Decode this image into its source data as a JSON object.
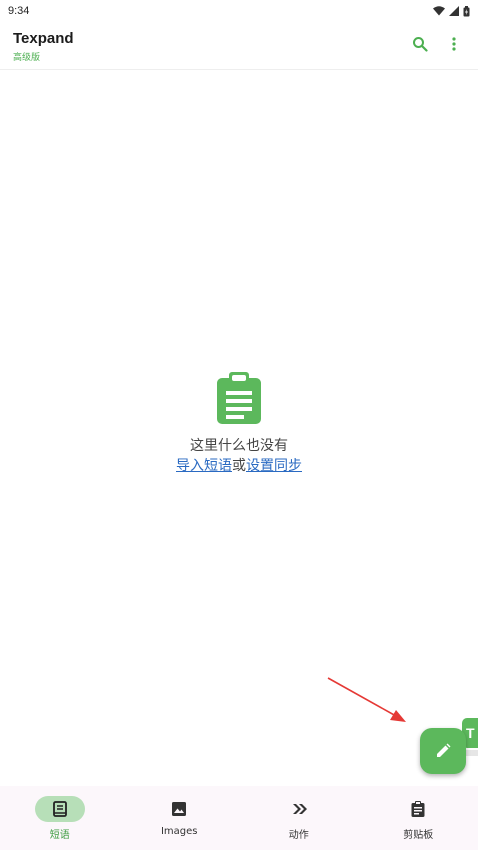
{
  "status_bar": {
    "time": "9:34"
  },
  "app_bar": {
    "title": "Texpand",
    "subtitle": "高级版"
  },
  "empty_state": {
    "message": "这里什么也没有",
    "import_link": "导入短语",
    "separator": "或",
    "sync_link": "设置同步"
  },
  "floating_tag": {
    "letter": "T"
  },
  "bottom_nav": {
    "items": [
      {
        "label": "短语",
        "icon": "book-icon",
        "active": true
      },
      {
        "label": "Images",
        "icon": "image-icon",
        "active": false
      },
      {
        "label": "动作",
        "icon": "double-chevron-icon",
        "active": false
      },
      {
        "label": "剪贴板",
        "icon": "clipboard-icon",
        "active": false
      }
    ]
  },
  "colors": {
    "accent": "#4caf50",
    "fab": "#5cb85c",
    "link": "#2a6ac2",
    "nav_active_bg": "#b7dfb8",
    "nav_bg": "#fcf7fb",
    "arrow": "#e53935"
  }
}
